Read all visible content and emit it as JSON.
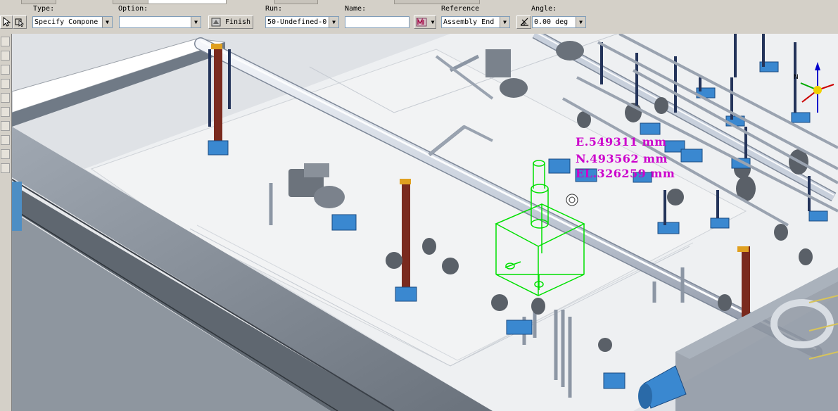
{
  "toolbar": {
    "type_label": "Type:",
    "type_value": "Specify Compone",
    "option_label": "Option:",
    "option_value": "",
    "finish_label": "Finish",
    "run_label": "Run:",
    "run_value": "50-Undefined-0",
    "name_label": "Name:",
    "name_value": "",
    "reference_label": "Reference",
    "reference_value": "Assembly End",
    "angle_label": "Angle:",
    "angle_value": "0.00 deg"
  },
  "viewport": {
    "coord_e": "E.549311 mm",
    "coord_n": "N.493562 mm",
    "coord_el": "EL.326259 mm",
    "highlight_color": "#00e000",
    "coord_color": "#cc00cc"
  },
  "icons": [
    "select-arrow-icon",
    "finish-icon",
    "routing-icon",
    "angle-icon",
    "compass-icon",
    "snap-icon"
  ]
}
